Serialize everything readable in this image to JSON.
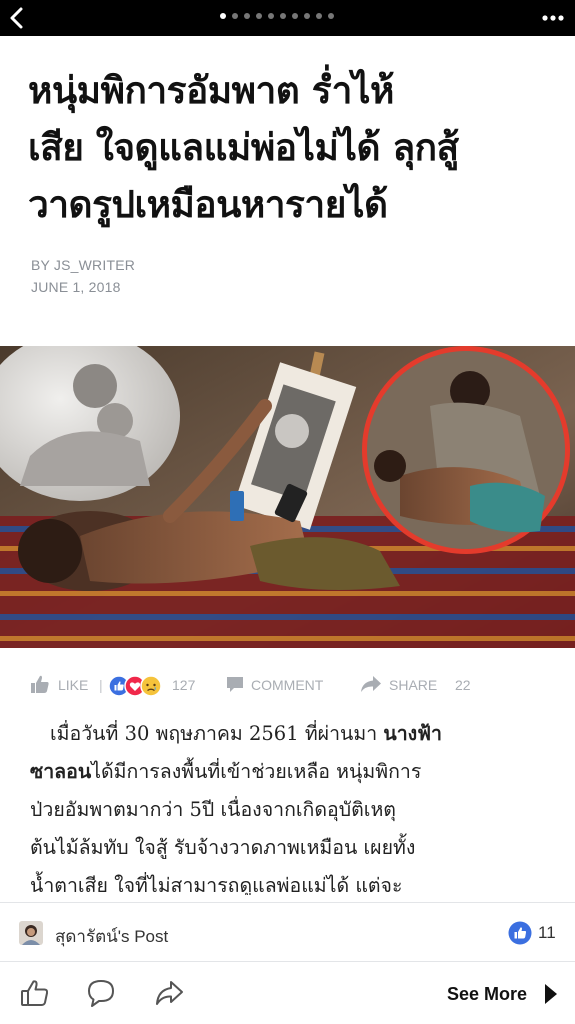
{
  "topbar": {
    "back_icon": "chevron-left-icon",
    "page_indicator": {
      "total": 10,
      "active": 0
    },
    "more_icon": "more-dots-icon"
  },
  "article": {
    "title_lines": [
      "หนุ่มพิการอัมพาต ร่ำไห้",
      "เสีย ใจดูแลแม่พ่อไม่ได้ ลุกสู้",
      "วาดรูปเหมือนหารายได้"
    ],
    "byline": "BY JS_WRITER",
    "date": "JUNE 1, 2018",
    "image_icon": "article-photo",
    "body": {
      "l1_a": "เมื่อวันที่ 30 พฤษภาคม 2561 ที่ผ่านมา ",
      "l1_b": "นางฟ้า",
      "l2_a": "ซาลอน",
      "l2_b": "ได้มีการลงพื้นที่เข้าช่วยเหลือ หนุ่มพิการ",
      "l3": "ป่วยอัมพาตมากว่า 5ปี เนื่องจากเกิดอุบัติเหตุ",
      "l4": "ต้นไม้ล้มทับ  ใจสู้ รับจ้างวาดภาพเหมือน เผยทั้ง",
      "l5": "น้ำตาเสีย ใจที่ไม่สามารถดูแลพ่อแม่ได้ แต่จะ"
    }
  },
  "actions": {
    "like_label": "LIKE",
    "separator": "|",
    "reaction_count": "127",
    "comment_label": "COMMENT",
    "share_label": "SHARE",
    "share_count": "22"
  },
  "post": {
    "label": "สุดารัตน์'s Post",
    "likes": "11"
  },
  "bottombar": {
    "see_more": "See More"
  },
  "colors": {
    "facebook_blue": "#3b6fe0",
    "reaction_red": "#f0284a",
    "muted_gray": "#a9adb3"
  }
}
